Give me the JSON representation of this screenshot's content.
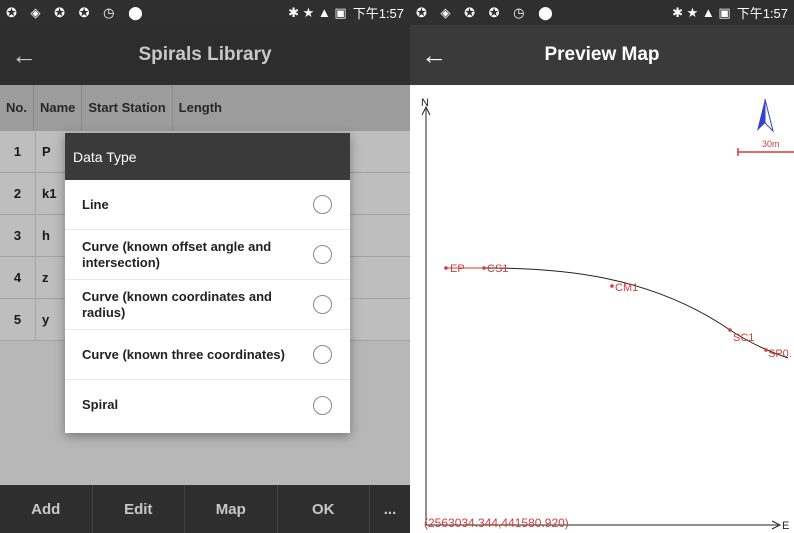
{
  "left": {
    "status": {
      "icons": "✪ ◈ ✪ ✪ ◷ ⬤",
      "sys": "✱ ★ ▲ ▣",
      "time": "下午1:57"
    },
    "title": "Spirals Library",
    "columns": [
      "No.",
      "Name",
      "Start Station",
      "Length"
    ],
    "rows": [
      {
        "no": "1",
        "name": "P"
      },
      {
        "no": "2",
        "name": "k1"
      },
      {
        "no": "3",
        "name": "h"
      },
      {
        "no": "4",
        "name": "z"
      },
      {
        "no": "5",
        "name": "y"
      }
    ],
    "dialog": {
      "title": "Data Type",
      "options": [
        "Line",
        "Curve (known offset angle and intersection)",
        "Curve (known coordinates and radius)",
        "Curve (known three coordinates)",
        "Spiral"
      ]
    },
    "buttons": [
      "Add",
      "Edit",
      "Map",
      "OK",
      "..."
    ]
  },
  "right": {
    "status": {
      "icons": "✪ ◈ ✪ ✪ ◷ ⬤",
      "sys": "✱ ★ ▲ ▣",
      "time": "下午1:57"
    },
    "title": "Preview Map",
    "axis_n": "N",
    "axis_e": "E",
    "scale": "30m",
    "points": [
      "EP",
      "CS1",
      "CM1",
      "SC1",
      "SP0."
    ],
    "origin": "(2563034.344,441580.920)",
    "accent": "#d63a3a"
  }
}
